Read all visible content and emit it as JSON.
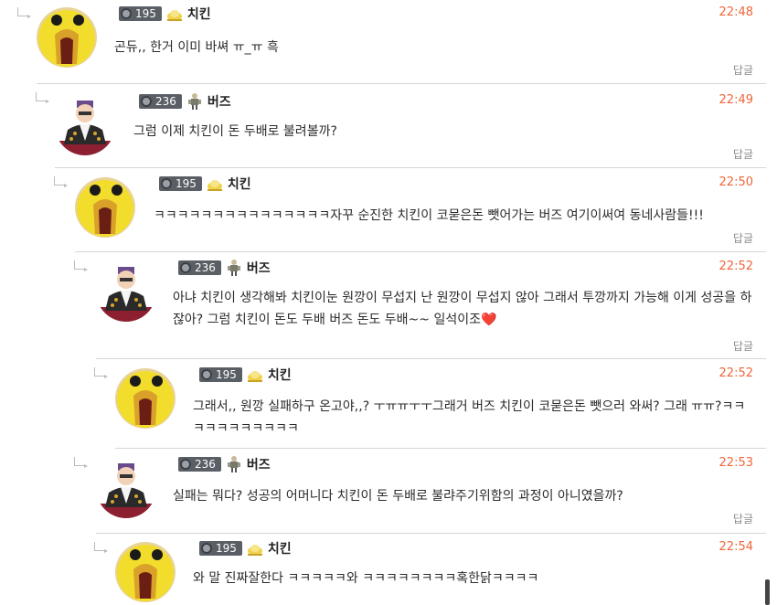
{
  "comments": [
    {
      "level": "195",
      "nick": "치킨",
      "time": "22:48",
      "text": "곤듀,, 한거 이미 바쎠 ㅠ_ㅠ 흑",
      "reply": "답글",
      "avatar": "chicken-avatar"
    },
    {
      "level": "236",
      "nick": "버즈",
      "time": "22:49",
      "text": "그럼 이제 치킨이 돈 두배로 불려볼까?",
      "reply": "답글",
      "avatar": "buzz-avatar"
    },
    {
      "level": "195",
      "nick": "치킨",
      "time": "22:50",
      "text": "ㅋㅋㅋㅋㅋㅋㅋㅋㅋㅋㅋㅋㅋㅋㅋ자꾸 순진한 치킨이 코묻은돈 뺏어가는 버즈 여기이써여 동네사람들!!!",
      "reply": "답글",
      "avatar": "chicken-avatar"
    },
    {
      "level": "236",
      "nick": "버즈",
      "time": "22:52",
      "text": "아냐 치킨이 생각해봐 치킨이눈 원깡이 무섭지 난 원깡이 무섭지 않아 그래서 투깡까지 가능해 이게 성공을 하잖아? 그럼 치킨이 돈도 두배 버즈 돈도 두배~~ 일석이조",
      "heart": "❤️",
      "reply": "답글",
      "avatar": "buzz-avatar"
    },
    {
      "level": "195",
      "nick": "치킨",
      "time": "22:52",
      "text": "그래서,, 원깡 실패하구 온고야,,? ㅜㅠㅠㅜㅜ그래거 버즈 치킨이 코묻은돈 뺏으러 와써? 그래 ㅠㅠ?ㅋㅋㅋㅋㅋㅋㅋㅋㅋㅋㅋ",
      "reply": "답글",
      "avatar": "chicken-avatar"
    },
    {
      "level": "236",
      "nick": "버즈",
      "time": "22:53",
      "text": "실패는 뭐다? 성공의 어머니다 치킨이 돈 두배로 불랴주기위함의 과정이 아니였을까?",
      "reply": "답글",
      "avatar": "buzz-avatar"
    },
    {
      "level": "195",
      "nick": "치킨",
      "time": "22:54",
      "text": "와 말 진짜잘한다 ㅋㅋㅋㅋㅋ와 ㅋㅋㅋㅋㅋㅋㅋㅋ혹한닭ㅋㅋㅋㅋ",
      "avatar": "chicken-avatar"
    }
  ],
  "colors": {
    "time": "#f0663a",
    "level_badge": "#5a5f66",
    "divider": "#d6d6d6"
  }
}
